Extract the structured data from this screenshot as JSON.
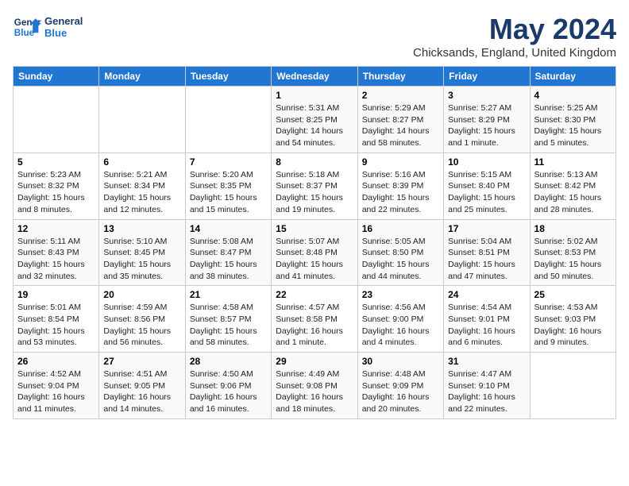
{
  "header": {
    "logo_line1": "General",
    "logo_line2": "Blue",
    "month": "May 2024",
    "location": "Chicksands, England, United Kingdom"
  },
  "weekdays": [
    "Sunday",
    "Monday",
    "Tuesday",
    "Wednesday",
    "Thursday",
    "Friday",
    "Saturday"
  ],
  "weeks": [
    [
      {
        "day": "",
        "sunrise": "",
        "sunset": "",
        "daylight": ""
      },
      {
        "day": "",
        "sunrise": "",
        "sunset": "",
        "daylight": ""
      },
      {
        "day": "",
        "sunrise": "",
        "sunset": "",
        "daylight": ""
      },
      {
        "day": "1",
        "sunrise": "Sunrise: 5:31 AM",
        "sunset": "Sunset: 8:25 PM",
        "daylight": "Daylight: 14 hours and 54 minutes."
      },
      {
        "day": "2",
        "sunrise": "Sunrise: 5:29 AM",
        "sunset": "Sunset: 8:27 PM",
        "daylight": "Daylight: 14 hours and 58 minutes."
      },
      {
        "day": "3",
        "sunrise": "Sunrise: 5:27 AM",
        "sunset": "Sunset: 8:29 PM",
        "daylight": "Daylight: 15 hours and 1 minute."
      },
      {
        "day": "4",
        "sunrise": "Sunrise: 5:25 AM",
        "sunset": "Sunset: 8:30 PM",
        "daylight": "Daylight: 15 hours and 5 minutes."
      }
    ],
    [
      {
        "day": "5",
        "sunrise": "Sunrise: 5:23 AM",
        "sunset": "Sunset: 8:32 PM",
        "daylight": "Daylight: 15 hours and 8 minutes."
      },
      {
        "day": "6",
        "sunrise": "Sunrise: 5:21 AM",
        "sunset": "Sunset: 8:34 PM",
        "daylight": "Daylight: 15 hours and 12 minutes."
      },
      {
        "day": "7",
        "sunrise": "Sunrise: 5:20 AM",
        "sunset": "Sunset: 8:35 PM",
        "daylight": "Daylight: 15 hours and 15 minutes."
      },
      {
        "day": "8",
        "sunrise": "Sunrise: 5:18 AM",
        "sunset": "Sunset: 8:37 PM",
        "daylight": "Daylight: 15 hours and 19 minutes."
      },
      {
        "day": "9",
        "sunrise": "Sunrise: 5:16 AM",
        "sunset": "Sunset: 8:39 PM",
        "daylight": "Daylight: 15 hours and 22 minutes."
      },
      {
        "day": "10",
        "sunrise": "Sunrise: 5:15 AM",
        "sunset": "Sunset: 8:40 PM",
        "daylight": "Daylight: 15 hours and 25 minutes."
      },
      {
        "day": "11",
        "sunrise": "Sunrise: 5:13 AM",
        "sunset": "Sunset: 8:42 PM",
        "daylight": "Daylight: 15 hours and 28 minutes."
      }
    ],
    [
      {
        "day": "12",
        "sunrise": "Sunrise: 5:11 AM",
        "sunset": "Sunset: 8:43 PM",
        "daylight": "Daylight: 15 hours and 32 minutes."
      },
      {
        "day": "13",
        "sunrise": "Sunrise: 5:10 AM",
        "sunset": "Sunset: 8:45 PM",
        "daylight": "Daylight: 15 hours and 35 minutes."
      },
      {
        "day": "14",
        "sunrise": "Sunrise: 5:08 AM",
        "sunset": "Sunset: 8:47 PM",
        "daylight": "Daylight: 15 hours and 38 minutes."
      },
      {
        "day": "15",
        "sunrise": "Sunrise: 5:07 AM",
        "sunset": "Sunset: 8:48 PM",
        "daylight": "Daylight: 15 hours and 41 minutes."
      },
      {
        "day": "16",
        "sunrise": "Sunrise: 5:05 AM",
        "sunset": "Sunset: 8:50 PM",
        "daylight": "Daylight: 15 hours and 44 minutes."
      },
      {
        "day": "17",
        "sunrise": "Sunrise: 5:04 AM",
        "sunset": "Sunset: 8:51 PM",
        "daylight": "Daylight: 15 hours and 47 minutes."
      },
      {
        "day": "18",
        "sunrise": "Sunrise: 5:02 AM",
        "sunset": "Sunset: 8:53 PM",
        "daylight": "Daylight: 15 hours and 50 minutes."
      }
    ],
    [
      {
        "day": "19",
        "sunrise": "Sunrise: 5:01 AM",
        "sunset": "Sunset: 8:54 PM",
        "daylight": "Daylight: 15 hours and 53 minutes."
      },
      {
        "day": "20",
        "sunrise": "Sunrise: 4:59 AM",
        "sunset": "Sunset: 8:56 PM",
        "daylight": "Daylight: 15 hours and 56 minutes."
      },
      {
        "day": "21",
        "sunrise": "Sunrise: 4:58 AM",
        "sunset": "Sunset: 8:57 PM",
        "daylight": "Daylight: 15 hours and 58 minutes."
      },
      {
        "day": "22",
        "sunrise": "Sunrise: 4:57 AM",
        "sunset": "Sunset: 8:58 PM",
        "daylight": "Daylight: 16 hours and 1 minute."
      },
      {
        "day": "23",
        "sunrise": "Sunrise: 4:56 AM",
        "sunset": "Sunset: 9:00 PM",
        "daylight": "Daylight: 16 hours and 4 minutes."
      },
      {
        "day": "24",
        "sunrise": "Sunrise: 4:54 AM",
        "sunset": "Sunset: 9:01 PM",
        "daylight": "Daylight: 16 hours and 6 minutes."
      },
      {
        "day": "25",
        "sunrise": "Sunrise: 4:53 AM",
        "sunset": "Sunset: 9:03 PM",
        "daylight": "Daylight: 16 hours and 9 minutes."
      }
    ],
    [
      {
        "day": "26",
        "sunrise": "Sunrise: 4:52 AM",
        "sunset": "Sunset: 9:04 PM",
        "daylight": "Daylight: 16 hours and 11 minutes."
      },
      {
        "day": "27",
        "sunrise": "Sunrise: 4:51 AM",
        "sunset": "Sunset: 9:05 PM",
        "daylight": "Daylight: 16 hours and 14 minutes."
      },
      {
        "day": "28",
        "sunrise": "Sunrise: 4:50 AM",
        "sunset": "Sunset: 9:06 PM",
        "daylight": "Daylight: 16 hours and 16 minutes."
      },
      {
        "day": "29",
        "sunrise": "Sunrise: 4:49 AM",
        "sunset": "Sunset: 9:08 PM",
        "daylight": "Daylight: 16 hours and 18 minutes."
      },
      {
        "day": "30",
        "sunrise": "Sunrise: 4:48 AM",
        "sunset": "Sunset: 9:09 PM",
        "daylight": "Daylight: 16 hours and 20 minutes."
      },
      {
        "day": "31",
        "sunrise": "Sunrise: 4:47 AM",
        "sunset": "Sunset: 9:10 PM",
        "daylight": "Daylight: 16 hours and 22 minutes."
      },
      {
        "day": "",
        "sunrise": "",
        "sunset": "",
        "daylight": ""
      }
    ]
  ]
}
